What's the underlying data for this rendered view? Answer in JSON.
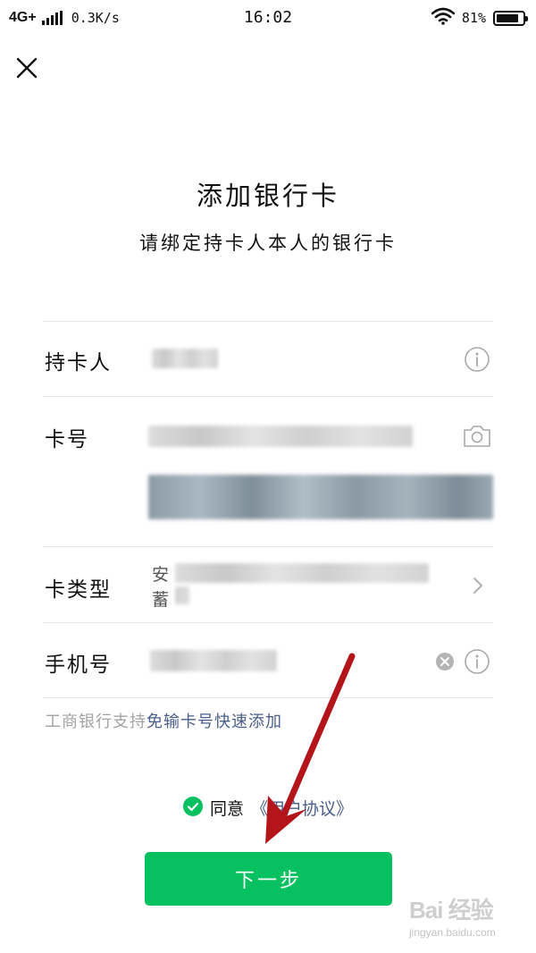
{
  "status_bar": {
    "network": "4G+",
    "speed": "0.3K/s",
    "time": "16:02",
    "battery": "81%"
  },
  "page": {
    "title": "添加银行卡",
    "subtitle": "请绑定持卡人本人的银行卡"
  },
  "form": {
    "cardholder_label": "持卡人",
    "card_number_label": "卡号",
    "card_type_label": "卡类型",
    "card_type_prefix_1": "安",
    "card_type_prefix_2": "蓄",
    "phone_label": "手机号"
  },
  "tip": {
    "text": "工商银行支持",
    "link": "免输卡号快速添加"
  },
  "agreement": {
    "text": "同意",
    "link": "《用户协议》"
  },
  "next_button": "下一步",
  "watermark": {
    "logo": "Bai 经验",
    "sub": "jingyan.baidu.com"
  },
  "colors": {
    "accent_green": "#07c160",
    "link_blue": "#4a5e8a",
    "arrow_red": "#b3151b"
  }
}
